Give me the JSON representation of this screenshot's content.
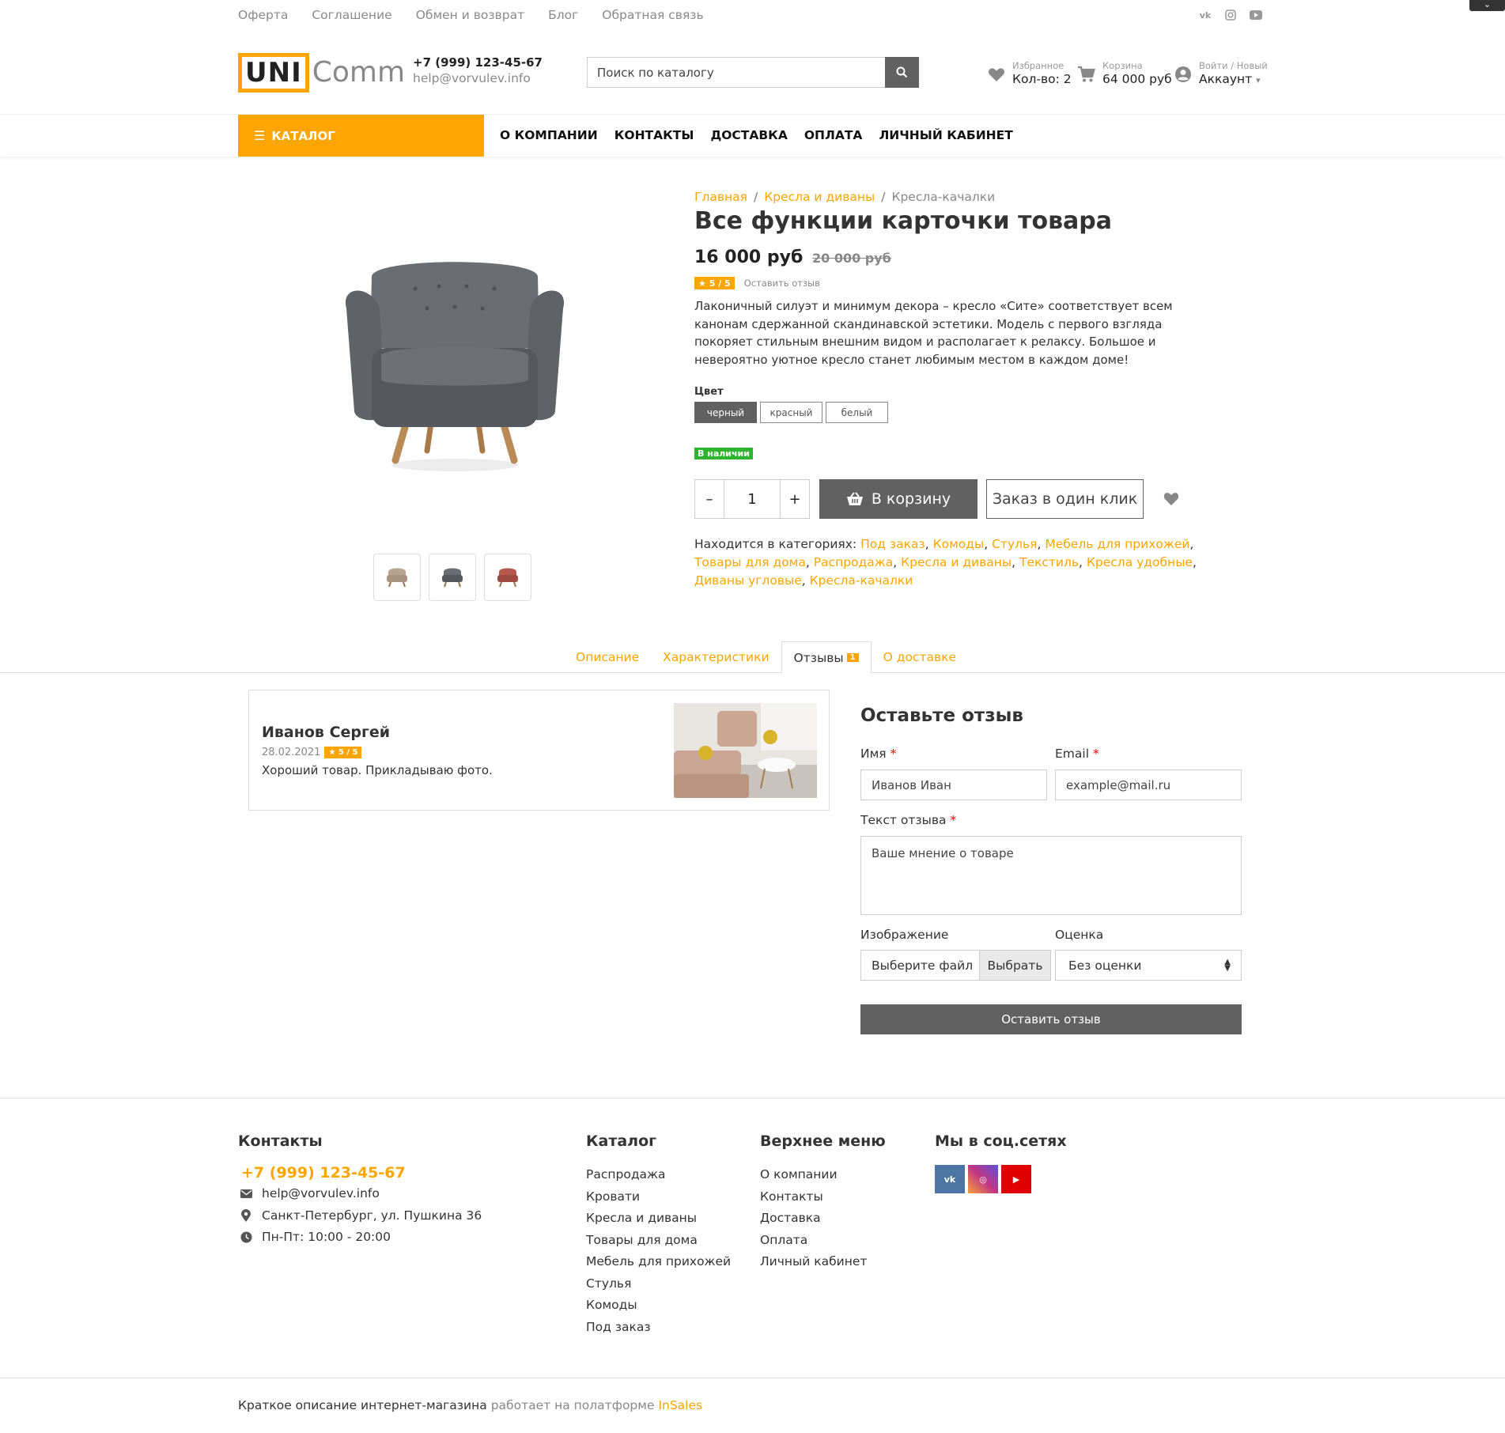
{
  "topbar": {
    "links": [
      "Оферта",
      "Соглашение",
      "Обмен и возврат",
      "Блог",
      "Обратная связь"
    ],
    "social_icons": [
      "vk-icon",
      "instagram-icon",
      "youtube-icon"
    ]
  },
  "header": {
    "logo_uni": "UNI",
    "logo_comm": "Comm",
    "phone": "+7 (999) 123-45-67",
    "email": "help@vorvulev.info",
    "search_placeholder": "Поиск по каталогу",
    "favorites_label": "Избранное",
    "favorites_value": "Кол-во: 2",
    "cart_label": "Корзина",
    "cart_value": "64 000 руб",
    "account_label": "Войти / Новый",
    "account_value": "Аккаунт"
  },
  "nav": {
    "catalog": "КАТАЛОГ",
    "items": [
      "О КОМПАНИИ",
      "КОНТАКТЫ",
      "ДОСТАВКА",
      "ОПЛАТА",
      "ЛИЧНЫЙ КАБИНЕТ"
    ]
  },
  "breadcrumbs": [
    "Главная",
    "Кресла и диваны",
    "Кресла-качалки"
  ],
  "product": {
    "title": "Все функции карточки товара",
    "price": "16 000 руб",
    "old_price": "20 000 руб",
    "rating": "5 / 5",
    "leave_review": "Оставить отзыв",
    "description": "Лаконичный силуэт и минимум декора – кресло «Сите» соответствует  всем канонам сдержанной скандинавской эстетики. Модель с первого взгляда покоряет стильным внешним видом и располагает к релаксу. Большое и невероятно уютное кресло станет любимым местом в каждом доме!",
    "color_label": "Цвет",
    "colors": [
      "черный",
      "красный",
      "белый"
    ],
    "selected_color": "черный",
    "stock": "В наличии",
    "qty_minus": "–",
    "qty": "1",
    "qty_plus": "+",
    "add_to_cart": "В корзину",
    "one_click": "Заказ в один клик",
    "categories_label": "Находится в категориях:",
    "categories": [
      "Под заказ",
      "Комоды",
      "Стулья",
      "Мебель для прихожей",
      "Товары для дома",
      "Распродажа",
      "Кресла и диваны",
      "Текстиль",
      "Кресла удобные",
      "Диваны угловые",
      "Кресла-качалки"
    ]
  },
  "tabs": {
    "items": [
      "Описание",
      "Характеристики",
      "Отзывы",
      "О доставке"
    ],
    "active": "Отзывы",
    "reviews_count": "1"
  },
  "review": {
    "author": "Иванов Сергей",
    "date": "28.02.2021",
    "rating": "5 / 5",
    "text": "Хороший товар. Прикладываю фото."
  },
  "review_form": {
    "title": "Оставьте отзыв",
    "name_label": "Имя",
    "name_value": "Иванов Иван",
    "email_label": "Email",
    "email_placeholder": "example@mail.ru",
    "text_label": "Текст отзыва",
    "text_placeholder": "Ваше мнение о товаре",
    "image_label": "Изображение",
    "file_placeholder": "Выберите файл",
    "file_button": "Выбрать",
    "rating_label": "Оценка",
    "rating_value": "Без оценки",
    "submit": "Оставить отзыв",
    "required_mark": "*"
  },
  "footer": {
    "contacts_title": "Контакты",
    "phone": "+7 (999) 123-45-67",
    "email": "help@vorvulev.info",
    "address": "Санкт-Петербург, ул. Пушкина 36",
    "hours": "Пн-Пт: 10:00 - 20:00",
    "catalog_title": "Каталог",
    "catalog_items": [
      "Распродажа",
      "Кровати",
      "Кресла и диваны",
      "Товары для дома",
      "Мебель для прихожей",
      "Стулья",
      "Комоды",
      "Под заказ"
    ],
    "menu_title": "Верхнее меню",
    "menu_items": [
      "О компании",
      "Контакты",
      "Доставка",
      "Оплата",
      "Личный кабинет"
    ],
    "social_title": "Мы в соц.сетях",
    "social": [
      {
        "icon": "vk-icon",
        "label": "vk",
        "color": "#4c75a3"
      },
      {
        "icon": "instagram-icon",
        "label": "◎",
        "color": "#c13584"
      },
      {
        "icon": "youtube-icon",
        "label": "▶",
        "color": "#e00000"
      }
    ],
    "copyright_desc": "Краткое описание интернет-магазина",
    "copyright_platform": "работает на полатформе",
    "copyright_link": "InSales"
  },
  "colors": {
    "accent": "#ffa500",
    "dark_button": "#616161",
    "stock": "#2db52d"
  }
}
